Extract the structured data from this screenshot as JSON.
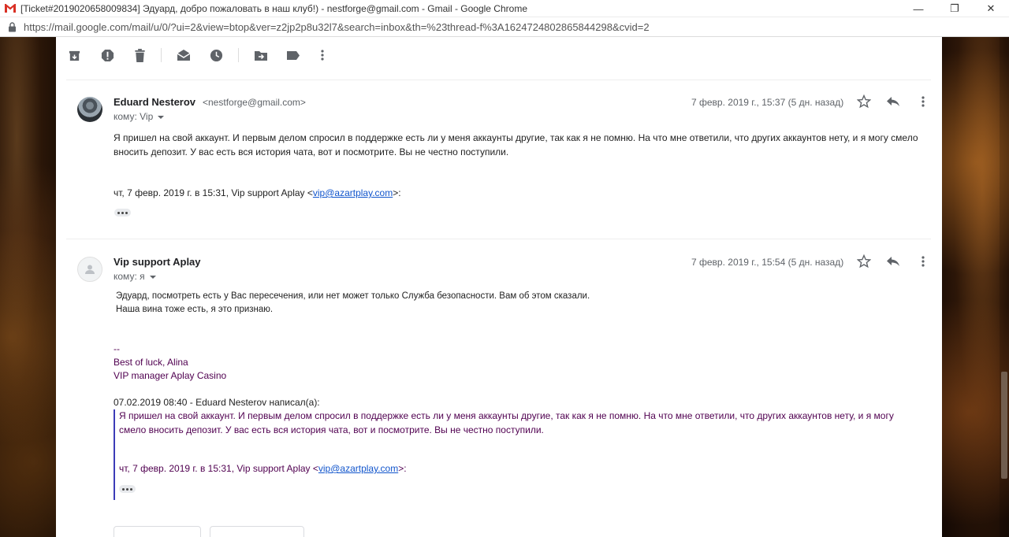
{
  "browser": {
    "tab_title": "[Ticket#2019020658009834] Эдуард, добро пожаловать в наш клуб!) - nestforge@gmail.com - Gmail - Google Chrome",
    "url": "https://mail.google.com/mail/u/0/?ui=2&view=btop&ver=z2jp2p8u32l7&search=inbox&th=%23thread-f%3A1624724802865844298&cvid=2",
    "minimize": "—",
    "maximize": "❐",
    "close": "✕"
  },
  "toolbar": {
    "icons": [
      "archive-icon",
      "report-spam-icon",
      "delete-icon",
      "mark-unread-icon",
      "snooze-icon",
      "move-to-icon",
      "label-icon",
      "more-vert-icon"
    ]
  },
  "messages": [
    {
      "sender": "Eduard Nesterov",
      "email": "<nestforge@gmail.com>",
      "to": "кому: Vip",
      "date": "7 февр. 2019 г., 15:37 (5 дн. назад)",
      "body": "Я пришел на свой аккаунт. И первым делом спросил в поддержке есть ли у меня аккаунты другие, так как я не помню. На что мне ответили, что других аккаунтов нету, и я могу смело вносить депозит. У вас есть вся история чата, вот и посмотрите. Вы не честно поступили.",
      "quote_prefix": "чт, 7 февр. 2019 г. в 15:31, Vip support Aplay <",
      "quote_link": "vip@azartplay.com",
      "quote_suffix": ">:"
    },
    {
      "sender": "Vip support Aplay",
      "to": "кому: я",
      "date": "7 февр. 2019 г., 15:54 (5 дн. назад)",
      "line1": "Эдуард, посмотреть есть у Вас пересечения, или нет может только Служба безопасности. Вам об этом сказали.",
      "line2": "Наша вина тоже есть, я это признаю.",
      "sig_dash": "--",
      "sig_line1": "Best of luck, Alina",
      "sig_line2": "VIP manager Aplay Casino",
      "quote_header": "07.02.2019 08:40 - Eduard Nesterov написал(а):",
      "quote_body": "Я пришел на свой аккаунт. И первым делом спросил в поддержке есть ли у меня аккаунты другие, так как я не помню. На что мне ответили, что других аккаунтов нету, и я могу смело вносить депозит. У вас есть вся история чата, вот и посмотрите. Вы не честно поступили.",
      "quote_prefix": "чт, 7 февр. 2019 г. в 15:31, Vip support Aplay <",
      "quote_link": "vip@azartplay.com",
      "quote_suffix": ">:"
    }
  ],
  "colors": {
    "link": "#1155cc",
    "signature": "#500050",
    "quote_bar": "#3c3cb8"
  }
}
